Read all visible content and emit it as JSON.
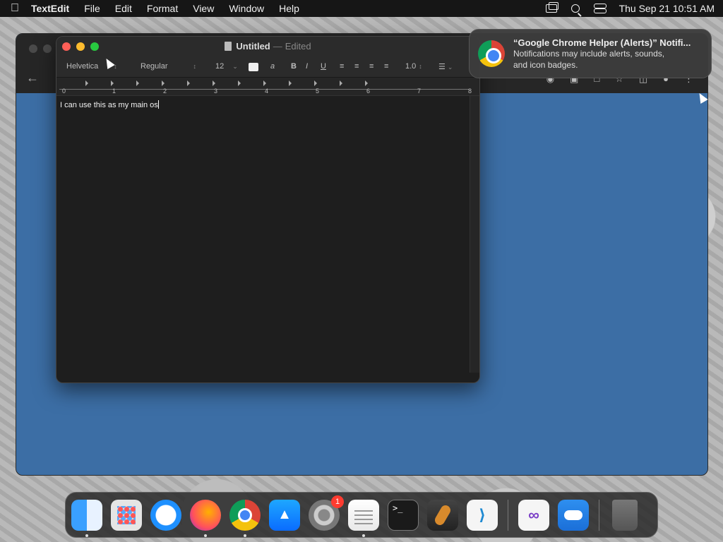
{
  "menubar": {
    "apple": "",
    "app_name": "TextEdit",
    "menus": [
      "File",
      "Edit",
      "Format",
      "View",
      "Window",
      "Help"
    ],
    "datetime": "Thu Sep 21  10:51 AM"
  },
  "textedit": {
    "title": "Untitled",
    "title_sep": "—",
    "status": "Edited",
    "toolbar": {
      "font_family": "Helvetica",
      "font_style": "Regular",
      "font_size": "12",
      "text_color_label": "a",
      "bold": "B",
      "italic": "I",
      "underline": "U",
      "line_spacing": "1.0"
    },
    "ruler": [
      "0",
      "1",
      "2",
      "3",
      "4",
      "5",
      "6",
      "7",
      "8"
    ],
    "content": "I can use this as my main os"
  },
  "notification": {
    "title": "“Google Chrome Helper (Alerts)” Notifi...",
    "body_line1": "Notifications may include alerts, sounds,",
    "body_line2": "and icon badges."
  },
  "dock": {
    "items": [
      {
        "name": "Finder",
        "running": true
      },
      {
        "name": "Launchpad",
        "running": false
      },
      {
        "name": "Safari",
        "running": false
      },
      {
        "name": "Firefox",
        "running": true
      },
      {
        "name": "Google Chrome",
        "running": true
      },
      {
        "name": "App Store",
        "running": false
      },
      {
        "name": "System Settings",
        "running": false,
        "badge": "1"
      },
      {
        "name": "TextEdit",
        "running": true
      },
      {
        "name": "Terminal",
        "running": false
      },
      {
        "name": "GarageBand",
        "running": false
      },
      {
        "name": "Visual Studio Code",
        "running": false
      },
      {
        "name": "Visual Studio",
        "running": false
      },
      {
        "name": "Weather",
        "running": false
      },
      {
        "name": "Trash",
        "running": false
      }
    ],
    "terminal_prompt": ">_",
    "vscode_glyph": "⟩",
    "vstudio_glyph": "∞"
  },
  "colors": {
    "menubar_bg": "#161616",
    "desktop_window_blue": "#3c6ea5",
    "close": "#ff5f57",
    "minimize": "#febc2e",
    "maximize": "#28c840"
  }
}
